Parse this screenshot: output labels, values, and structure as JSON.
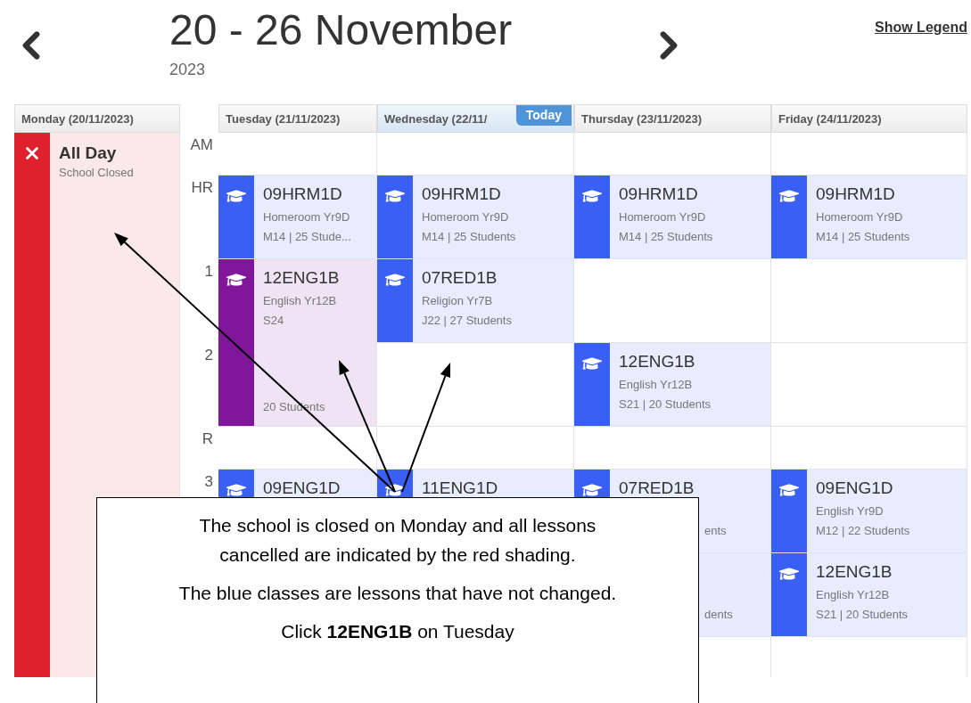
{
  "header": {
    "title": "20 - 26 November",
    "year": "2023",
    "legend_link": "Show Legend"
  },
  "closed_day": {
    "header": "Monday (20/11/2023)",
    "title": "All Day",
    "subtitle": "School Closed",
    "color": "#e0202c"
  },
  "periods": [
    {
      "kind": "break",
      "label": "AM"
    },
    {
      "kind": "lesson",
      "label": "HR"
    },
    {
      "kind": "lesson",
      "label": "1"
    },
    {
      "kind": "lesson",
      "label": "2"
    },
    {
      "kind": "break",
      "label": "R"
    },
    {
      "kind": "lesson",
      "label": "3"
    },
    {
      "kind": "lesson"
    },
    {
      "kind": "lesson"
    }
  ],
  "days": [
    {
      "label": "Tuesday (21/11/2023)",
      "today": false,
      "slots": [
        {
          "kind": "empty"
        },
        {
          "kind": "lesson",
          "color": "#3a5ff5",
          "code": "09HRM1D",
          "lines": [
            "Homeroom Yr9D",
            "M14 | 25 Stude..."
          ]
        },
        {
          "kind": "double",
          "color": "#80179a",
          "code": "12ENG1B",
          "lines": [
            "English Yr12B",
            "S24"
          ],
          "footer": "20 Students"
        },
        {
          "kind": "empty"
        },
        {
          "kind": "lesson",
          "color": "#3a5ff5",
          "code": "09ENG1D"
        }
      ]
    },
    {
      "label": "Wednesday (22/11/",
      "today": true,
      "badge": "Today",
      "slots": [
        {
          "kind": "empty"
        },
        {
          "kind": "lesson",
          "color": "#3a5ff5",
          "code": "09HRM1D",
          "lines": [
            "Homeroom Yr9D",
            "M14 | 25 Students"
          ]
        },
        {
          "kind": "lesson",
          "color": "#3a5ff5",
          "code": "07RED1B",
          "lines": [
            "Religion Yr7B",
            "J22 | 27 Students"
          ]
        },
        {
          "kind": "empty"
        },
        {
          "kind": "empty"
        },
        {
          "kind": "lesson",
          "color": "#3a5ff5",
          "code": "11ENG1D"
        }
      ]
    },
    {
      "label": "Thursday (23/11/2023)",
      "today": false,
      "slots": [
        {
          "kind": "empty"
        },
        {
          "kind": "lesson",
          "color": "#3a5ff5",
          "code": "09HRM1D",
          "lines": [
            "Homeroom Yr9D",
            "M14 | 25 Students"
          ]
        },
        {
          "kind": "empty"
        },
        {
          "kind": "lesson",
          "color": "#3a5ff5",
          "code": "12ENG1B",
          "lines": [
            "English Yr12B",
            "S21 | 20 Students"
          ]
        },
        {
          "kind": "empty"
        },
        {
          "kind": "lesson",
          "color": "#3a5ff5",
          "code": "07RED1B",
          "fragment": "ents"
        },
        {
          "kind": "hidden",
          "fragment": "dents"
        },
        {
          "kind": "empty"
        }
      ]
    },
    {
      "label": "Friday (24/11/2023)",
      "today": false,
      "slots": [
        {
          "kind": "empty"
        },
        {
          "kind": "lesson",
          "color": "#3a5ff5",
          "code": "09HRM1D",
          "lines": [
            "Homeroom Yr9D",
            "M14 | 25 Students"
          ]
        },
        {
          "kind": "empty"
        },
        {
          "kind": "empty"
        },
        {
          "kind": "empty"
        },
        {
          "kind": "lesson",
          "color": "#3a5ff5",
          "code": "09ENG1D",
          "lines": [
            "English Yr9D",
            "M12 | 22 Students"
          ]
        },
        {
          "kind": "lesson",
          "color": "#3a5ff5",
          "code": "12ENG1B",
          "lines": [
            "English Yr12B",
            "S21 | 20 Students"
          ]
        },
        {
          "kind": "empty"
        }
      ]
    }
  ],
  "callout": {
    "paragraphs": [
      "The school is closed on Monday and all lessons cancelled are indicated by the red shading.",
      "The blue classes are lessons that have not changed.",
      "Click **12ENG1B** on Tuesday"
    ]
  }
}
